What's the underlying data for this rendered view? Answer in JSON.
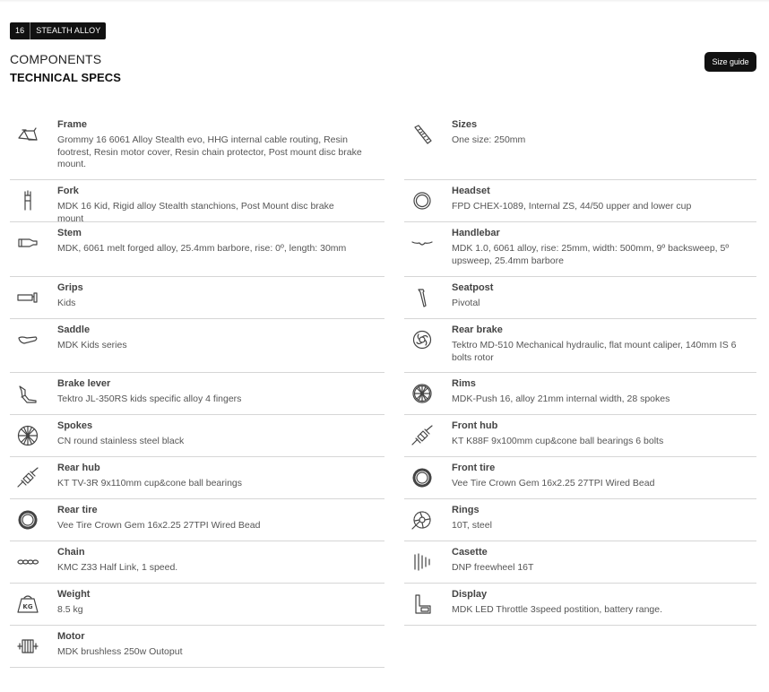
{
  "badge": {
    "number": "16",
    "model": "STEALTH ALLOY"
  },
  "header": {
    "components": "COMPONENTS",
    "technical_specs": "TECHNICAL SPECS",
    "size_guide": "Size guide"
  },
  "specs": [
    {
      "label": "Frame",
      "value": "Grommy 16 6061 Alloy Stealth evo, HHG internal cable routing, Resin footrest, Resin motor cover, Resin chain protector, Post mount disc brake mount.",
      "icon": "frame-icon"
    },
    {
      "label": "Sizes",
      "value": "One size: 250mm",
      "icon": "ruler-icon"
    },
    {
      "label": "Fork",
      "value": "MDK 16 Kid, Rigid alloy Stealth stanchions, Post Mount disc brake mount",
      "icon": "fork-icon"
    },
    {
      "label": "Headset",
      "value": "FPD CHEX-1089, Internal ZS, 44/50 upper and lower cup",
      "icon": "headset-icon"
    },
    {
      "label": "Stem",
      "value": "MDK, 6061 melt forged alloy, 25.4mm barbore, rise: 0º, length: 30mm",
      "icon": "stem-icon"
    },
    {
      "label": "Handlebar",
      "value": "MDK 1.0, 6061 alloy, rise: 25mm, width: 500mm, 9º backsweep, 5º upsweep, 25.4mm barbore",
      "icon": "handlebar-icon"
    },
    {
      "label": "Grips",
      "value": "Kids",
      "icon": "grip-icon"
    },
    {
      "label": "Seatpost",
      "value": "Pivotal",
      "icon": "seatpost-icon"
    },
    {
      "label": "Saddle",
      "value": "MDK Kids series",
      "icon": "saddle-icon"
    },
    {
      "label": "Rear brake",
      "value": "Tektro MD-510 Mechanical hydraulic, flat mount caliper, 140mm IS 6 bolts rotor",
      "icon": "brake-rotor-icon"
    },
    {
      "label": "Brake lever",
      "value": "Tektro JL-350RS kids specific alloy 4 fingers",
      "icon": "brake-lever-icon"
    },
    {
      "label": "Rims",
      "value": "MDK-Push 16, alloy 21mm internal width, 28 spokes",
      "icon": "rim-icon"
    },
    {
      "label": "Spokes",
      "value": "CN round stainless steel black",
      "icon": "spokes-icon"
    },
    {
      "label": "Front hub",
      "value": "KT K88F 9x100mm cup&cone ball bearings 6 bolts",
      "icon": "front-hub-icon"
    },
    {
      "label": "Rear hub",
      "value": "KT TV-3R 9x110mm cup&cone ball bearings",
      "icon": "rear-hub-icon"
    },
    {
      "label": "Front tire",
      "value": "Vee Tire Crown Gem 16x2.25 27TPI Wired Bead",
      "icon": "tire-icon"
    },
    {
      "label": "Rear tire",
      "value": "Vee Tire Crown Gem 16x2.25 27TPI Wired Bead",
      "icon": "tire-icon"
    },
    {
      "label": "Rings",
      "value": "10T, steel",
      "icon": "chainring-icon"
    },
    {
      "label": "Chain",
      "value": "KMC Z33 Half Link, 1 speed.",
      "icon": "chain-icon"
    },
    {
      "label": "Casette",
      "value": "DNP freewheel 16T",
      "icon": "cassette-icon"
    },
    {
      "label": "Weight",
      "value": "8.5 kg",
      "icon": "weight-icon"
    },
    {
      "label": "Display",
      "value": "MDK LED Throttle 3speed postition, battery range.",
      "icon": "display-icon"
    },
    {
      "label": "Motor",
      "value": "MDK brushless 250w Outoput",
      "icon": "motor-icon"
    }
  ]
}
